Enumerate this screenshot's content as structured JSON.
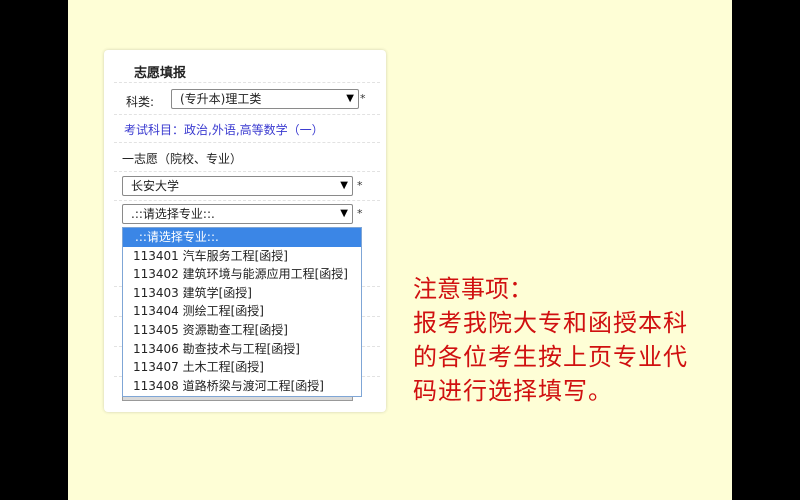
{
  "form": {
    "title": "志愿填报",
    "category_label": "科类:",
    "category_value": "(专升本)理工类",
    "exam_subjects": "考试科目：政治,外语,高等数学（一）",
    "first_choice_label": "一志愿（院校、专业）",
    "school_value": "长安大学",
    "major_placeholder": ".::请选择专业::.",
    "required_mark": "*",
    "arrow": "▼"
  },
  "dropdown": {
    "options": [
      ".::请选择专业::.",
      "113401 汽车服务工程[函授]",
      "113402 建筑环境与能源应用工程[函授]",
      "113403 建筑学[函授]",
      "113404 测绘工程[函授]",
      "113405 资源勘查工程[函授]",
      "113406 勘查技术与工程[函授]",
      "113407 土木工程[函授]",
      "113408 道路桥梁与渡河工程[函授]"
    ]
  },
  "notice": {
    "title": "注意事项：",
    "body": "报考我院大专和函授本科的各位考生按上页专业代码进行选择填写。"
  },
  "colors": {
    "slide_background": "#fefed6",
    "notice_text": "#d01010",
    "link_text": "#3a3ad0",
    "selected_option": "#3b86e6"
  }
}
